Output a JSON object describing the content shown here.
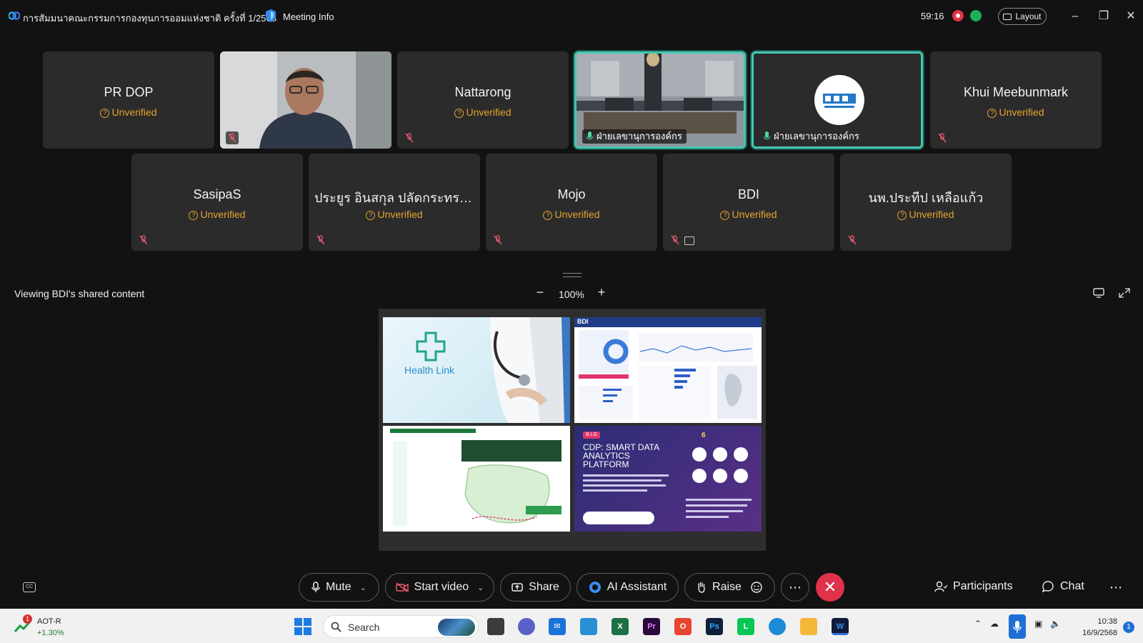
{
  "titlebar": {
    "meeting_title": "การสัมมนาคณะกรรมการกองทุนการออมแห่งชาติ ครั้งที่ 1/2568",
    "meeting_info": "Meeting Info",
    "timer": "59:16",
    "layout_label": "Layout"
  },
  "participants": [
    {
      "name": "PR DOP",
      "status": "Unverified",
      "video": false
    },
    {
      "name": "",
      "status": "",
      "video": true,
      "feed": "person-camera"
    },
    {
      "name": "Nattarong",
      "status": "Unverified",
      "video": false
    },
    {
      "name": "ฝ่ายเลขานุการองค์กร",
      "status": "",
      "video": true,
      "feed": "room-camera",
      "active": true
    },
    {
      "name": "ฝ่ายเลขานุการองค์กร",
      "status": "",
      "video": true,
      "feed": "logo",
      "active": true
    },
    {
      "name": "Khui Meebunmark",
      "status": "Unverified",
      "video": false
    },
    {
      "name": "SasipaS",
      "status": "Unverified",
      "video": false
    },
    {
      "name": "ประยูร อินสกุล ปลัดกระทรว...",
      "status": "Unverified",
      "video": false
    },
    {
      "name": "Mojo",
      "status": "Unverified",
      "video": false
    },
    {
      "name": "BDI",
      "status": "Unverified",
      "video": false,
      "sharing": true
    },
    {
      "name": "นพ.ประทีป   เหลือแก้ว",
      "status": "Unverified",
      "video": false
    }
  ],
  "share": {
    "viewing_label": "Viewing BDI's shared content",
    "zoom": "100%",
    "panels": {
      "health_link": "Health Link",
      "bdi_badge": "BDI",
      "cdp_tag": "B.I.G",
      "cdp_title": "CDP: SMART DATA ANALYTICS PLATFORM",
      "cdp_count": "6"
    }
  },
  "toolbar": {
    "mute": "Mute",
    "start_video": "Start video",
    "share": "Share",
    "ai_assistant": "AI Assistant",
    "raise": "Raise",
    "participants": "Participants",
    "chat": "Chat"
  },
  "taskbar": {
    "stock_name": "AOT-R",
    "stock_change": "+1.30%",
    "stock_badge": "1",
    "search": "Search",
    "time": "10:38",
    "date": "16/9/2568",
    "notifications": "1"
  },
  "colors": {
    "background": "#121212",
    "tile": "#2b2b2b",
    "active_border": "#46c7b2",
    "unverified": "#e5a42e",
    "end_call": "#e0324a"
  }
}
